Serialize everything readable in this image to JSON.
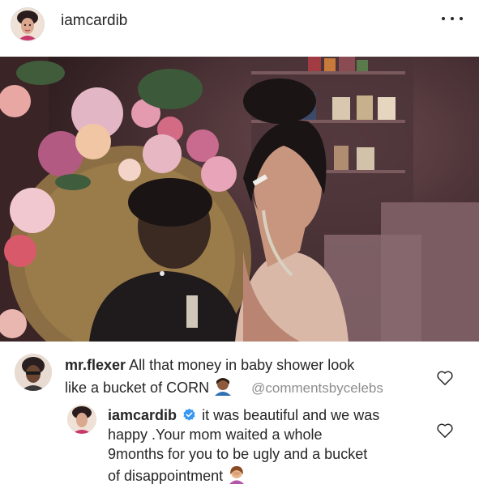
{
  "post": {
    "username": "iamcardib",
    "avatar_icon": "profile-avatar",
    "more_icon": "more-options-icon"
  },
  "photo": {
    "description_icon": "post-photo"
  },
  "comments": [
    {
      "username": "mr.flexer",
      "text_line1": "All that money in baby shower look",
      "text_line2": "like a bucket of CORN",
      "watermark": "@commentsbycelebs",
      "emoji": "person-emoji"
    },
    {
      "username": "iamcardib",
      "verified": true,
      "text_line1": "it was beautiful and we was",
      "text_line2": "happy .Your mom waited a whole",
      "text_line3": "9months for you to be ugly and a bucket",
      "text_line4": "of disappointment",
      "emoji": "woman-facepalming-emoji"
    }
  ],
  "colors": {
    "text": "#262626",
    "muted": "#8e8e8e",
    "verified": "#3897f0"
  }
}
